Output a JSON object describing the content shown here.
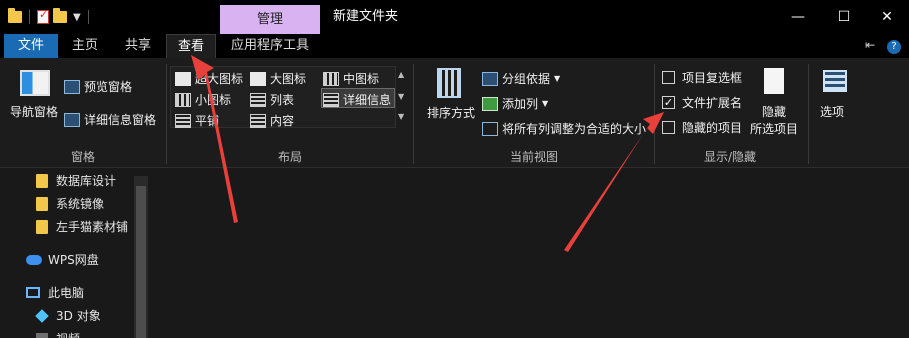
{
  "titlebar": {
    "context_tab": "管理",
    "title": "新建文件夹",
    "minimize_glyph": "—",
    "maximize_glyph": "☐",
    "close_glyph": "✕"
  },
  "tabs": [
    "文件",
    "主页",
    "共享",
    "查看",
    "应用程序工具"
  ],
  "tabs_right": {
    "pin_glyph": "⇤",
    "help_glyph": "?"
  },
  "ribbon": {
    "pane": {
      "nav_pane": "导航窗格",
      "preview_pane": "预览窗格",
      "details_pane": "详细信息窗格",
      "group": "窗格"
    },
    "layout": {
      "xl_icons": "超大图标",
      "large_icons": "大图标",
      "medium_icons": "中图标",
      "small_icons": "小图标",
      "list": "列表",
      "details": "详细信息",
      "tiles": "平铺",
      "content": "内容",
      "group": "布局"
    },
    "current_view": {
      "sort_by": "排序方式",
      "group_by": "分组依据",
      "add_column": "添加列",
      "fit_columns": "将所有列调整为合适的大小",
      "group": "当前视图"
    },
    "show_hide": {
      "item_checkboxes": "项目复选框",
      "file_extensions": "文件扩展名",
      "hidden_items": "隐藏的项目",
      "hide_selected_1": "隐藏",
      "hide_selected_2": "所选项目",
      "group": "显示/隐藏"
    },
    "options": "选项"
  },
  "checkboxes": {
    "item_checkboxes": false,
    "file_extensions": true,
    "hidden_items": false
  },
  "nav": {
    "items": [
      "数据库设计",
      "系统镜像",
      "左手猫素材铺",
      "WPS网盘",
      "此电脑",
      "3D 对象",
      "视频"
    ]
  },
  "colors": {
    "accent": "#1a6bb3",
    "context_tab": "#d9b2f2",
    "arrow": "#e8413c"
  }
}
